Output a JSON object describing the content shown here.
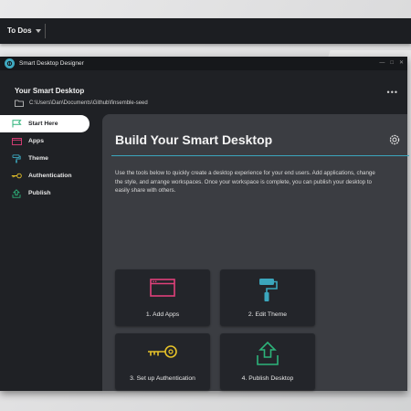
{
  "taskbar": {
    "todos_label": "To Dos"
  },
  "window": {
    "title": "Smart Desktop Designer",
    "controls": [
      "—",
      "□",
      "✕"
    ]
  },
  "header": {
    "title": "Your Smart Desktop",
    "path": "C:\\Users\\Dan\\Documents\\Github\\finsemble-seed"
  },
  "sidebar": {
    "items": [
      {
        "label": "Start Here",
        "icon": "start-flag-icon",
        "active": true,
        "color": "#2db37a"
      },
      {
        "label": "Apps",
        "icon": "apps-window-icon",
        "color": "#e0407a"
      },
      {
        "label": "Theme",
        "icon": "paint-roller-icon",
        "color": "#3ba6bd"
      },
      {
        "label": "Authentication",
        "icon": "key-icon",
        "color": "#e6c229"
      },
      {
        "label": "Publish",
        "icon": "publish-upload-icon",
        "color": "#2db37a"
      }
    ]
  },
  "main": {
    "title": "Build Your Smart Desktop",
    "description": "Use the tools below to quickly create  a desktop experience for your end users. Add applications, change the style, and arrange workspaces. Once your workspace is complete, you can publish your desktop to easily share with others.",
    "cards": [
      {
        "label": "1. Add Apps",
        "icon": "apps-window-icon"
      },
      {
        "label": "2. Edit Theme",
        "icon": "paint-roller-icon"
      },
      {
        "label": "3. Set up Authentication",
        "icon": "key-icon"
      },
      {
        "label": "4. Publish Desktop",
        "icon": "publish-upload-icon"
      }
    ]
  },
  "colors": {
    "accent_teal": "#3ba6bd",
    "pink": "#e0407a",
    "yellow": "#e6c229",
    "green": "#2db37a",
    "window_bg": "#1f2125",
    "panel_bg": "#3b3d42",
    "card_bg": "#23252a"
  }
}
